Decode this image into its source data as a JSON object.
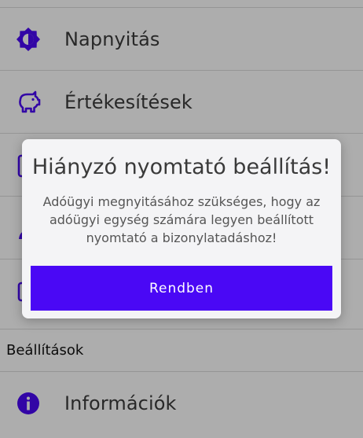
{
  "menu": {
    "items": [
      {
        "label": "Napnyitás",
        "icon": "brightness-icon"
      },
      {
        "label": "Értékesítések",
        "icon": "piggy-bank-icon"
      },
      {
        "label": "",
        "icon": "document-icon"
      },
      {
        "label": "",
        "icon": "person-icon"
      },
      {
        "label": "",
        "icon": "document-icon"
      }
    ],
    "section_header": "Beállítások",
    "info_item": {
      "label": "Információk",
      "icon": "info-icon"
    }
  },
  "dialog": {
    "title": "Hiányzó nyomtató beállítás!",
    "message": "Adóügyi megnyitásához szükséges, hogy az adóügyi egység számára legyen beállított nyomtató a bizonylatadáshoz!",
    "button_label": "Rendben"
  },
  "colors": {
    "accent": "#4a08f5",
    "overlay": "rgba(0,0,0,0.32)"
  }
}
